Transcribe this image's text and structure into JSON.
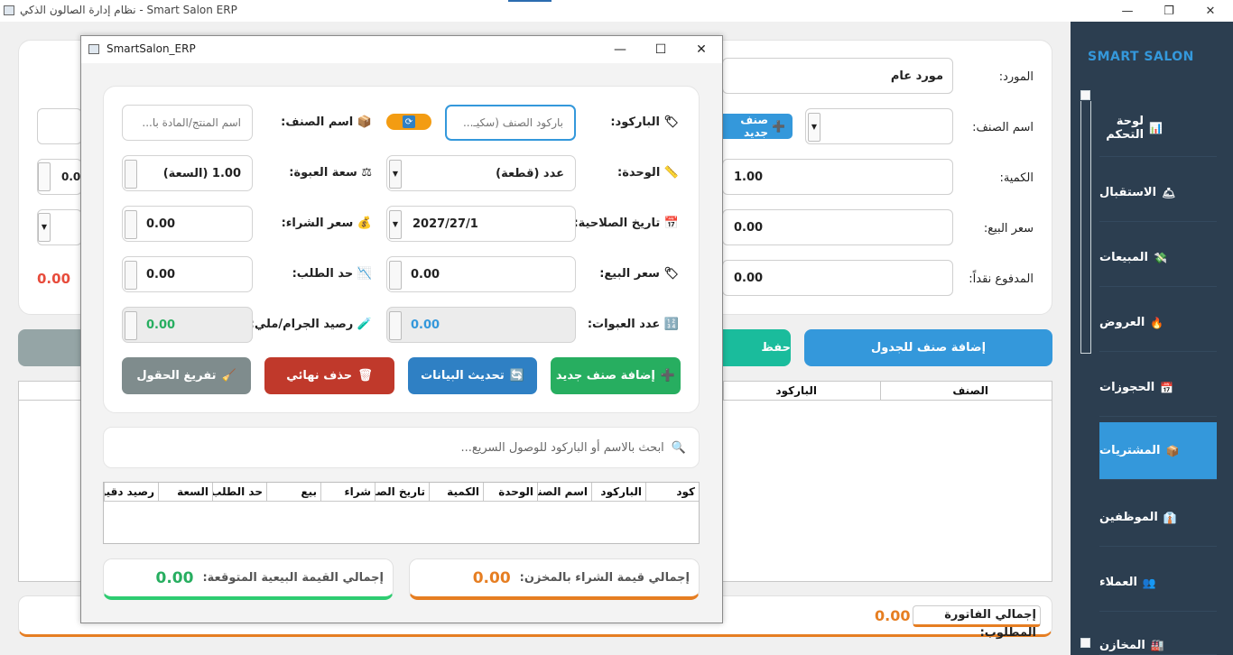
{
  "window": {
    "title": "نظام إدارة الصالون الذكي - Smart Salon ERP",
    "minimize": "—",
    "restore": "❐",
    "close": "✕"
  },
  "sidebar": {
    "logo": "SMART SALON",
    "items": [
      {
        "label": "لوحة التحكم",
        "icon": "📊"
      },
      {
        "label": "الاستقبال",
        "icon": "🛎"
      },
      {
        "label": "المبيعات",
        "icon": "💸"
      },
      {
        "label": "العروض",
        "icon": "🔥"
      },
      {
        "label": "الحجوزات",
        "icon": "📅"
      },
      {
        "label": "المشتريات",
        "icon": "📦"
      },
      {
        "label": "الموظفين",
        "icon": "👔"
      },
      {
        "label": "العملاء",
        "icon": "👥"
      },
      {
        "label": "المخازن",
        "icon": "🏭"
      }
    ],
    "active_index": 5,
    "active_color": "#3498db",
    "bg_color": "#2c3e50"
  },
  "purchase_form": {
    "supplier_label": "المورد:",
    "supplier_value": "مورد عام",
    "item_label": "اسم الصنف:",
    "new_item_button": "صنف جديد",
    "qty_label": "الكمية:",
    "qty_value": "1.00",
    "sell_price_label": "سعر البيع:",
    "sell_price_value": "0.00",
    "paid_cash_label": "المدفوع نقداً:",
    "paid_cash_value": "0.00",
    "left_partial_values": [
      "0.00"
    ],
    "red_value": "0.00",
    "add_to_table_button": "إضافة صنف للجدول",
    "save_partial": "حفظ",
    "table_headers": [
      "الصنف",
      "الباركود"
    ],
    "invoice_total_label": "إجمالي الفاتورة المطلوب:",
    "invoice_total_value": "0.00"
  },
  "dialog": {
    "title": "SmartSalon_ERP",
    "barcode_label": "الباركود:",
    "barcode_icon": "🏷",
    "barcode_placeholder": "باركود الصنف (سكيـ...",
    "item_name_label": "اسم الصنف:",
    "item_name_icon": "📦",
    "item_name_placeholder": "اسم المنتج/المادة با...",
    "unit_label": "الوحدة:",
    "unit_icon": "📏",
    "unit_value": "عدد (قطعة)",
    "pack_size_label": "سعة العبوة:",
    "pack_size_icon": "⚖",
    "pack_size_value": "1.00 (السعة)",
    "expiry_label": "تاريخ الصلاحية:",
    "expiry_icon": "📅",
    "expiry_value": "2027/27/1",
    "buy_price_label": "سعر الشراء:",
    "buy_price_icon": "💰",
    "buy_price_value": "0.00",
    "sell_price_label": "سعر البيع:",
    "sell_price_icon": "🏷",
    "sell_price_value": "0.00",
    "reorder_label": "حد الطلب:",
    "reorder_icon": "📉",
    "reorder_value": "0.00",
    "packs_label": "عدد العبوات:",
    "packs_icon": "🔢",
    "packs_value": "0.00",
    "balance_label": "رصيد الجرام/ملي:",
    "balance_icon": "🧪",
    "balance_value": "0.00",
    "buttons": {
      "add_new": "إضافة صنف جديد",
      "update": "تحديث البيانات",
      "delete": "حذف نهائي",
      "clear": "تفريغ الحقول"
    },
    "button_colors": {
      "add_new": "#27ae60",
      "update": "#2f80c4",
      "delete": "#c0392b",
      "clear": "#7f8c8d"
    },
    "search_placeholder": "ابحث بالاسم أو الباركود للوصول السريع...",
    "table_headers": [
      "كود",
      "الباركود",
      "اسم الصنف",
      "الوحدة",
      "الكمية",
      "تاريخ الصلاحية",
      "شراء",
      "بيع",
      "حد الطلب",
      "السعة",
      "رصيد دقيق"
    ],
    "total_buy_label": "إجمالي قيمة الشراء بالمخزن:",
    "total_buy_value": "0.00",
    "total_sell_label": "إجمالي القيمة البيعية المتوقعة:",
    "total_sell_value": "0.00"
  }
}
